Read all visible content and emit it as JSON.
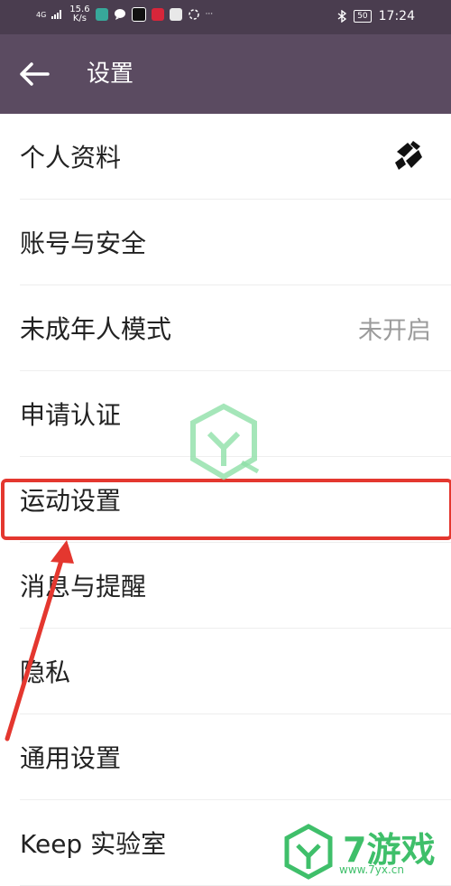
{
  "status_bar": {
    "signal": "4G",
    "speed": "15.6",
    "speed_unit": "K/s",
    "battery": "50",
    "time": "17:24",
    "overflow": "···"
  },
  "header": {
    "title": "设置"
  },
  "settings": [
    {
      "label": "个人资料",
      "value": ""
    },
    {
      "label": "账号与安全",
      "value": ""
    },
    {
      "label": "未成年人模式",
      "value": "未开启"
    },
    {
      "label": "申请认证",
      "value": ""
    },
    {
      "label": "运动设置",
      "value": ""
    },
    {
      "label": "消息与提醒",
      "value": ""
    },
    {
      "label": "隐私",
      "value": ""
    },
    {
      "label": "通用设置",
      "value": ""
    },
    {
      "label": "Keep 实验室",
      "value": ""
    }
  ],
  "watermark": {
    "brand": "7游戏",
    "url": "www.7yx.cn"
  },
  "colors": {
    "header_bg": "#5b4b61",
    "status_bg": "#4a3d4f",
    "highlight": "#e4372f",
    "watermark": "#3fbf6a"
  }
}
